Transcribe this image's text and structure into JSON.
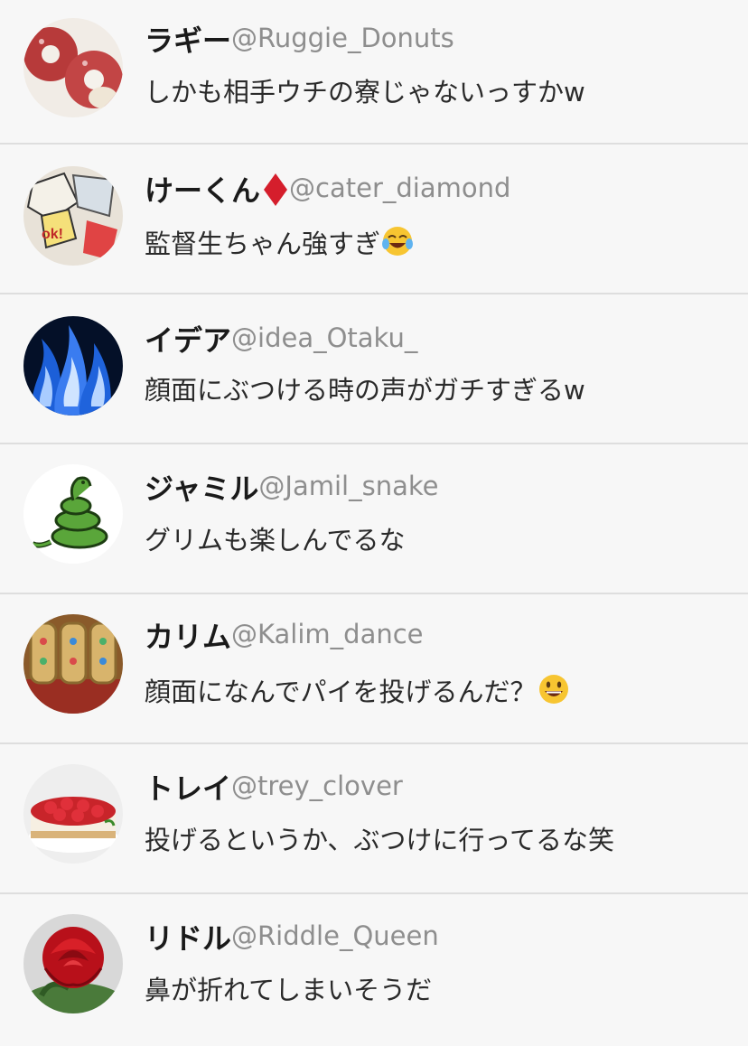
{
  "posts": [
    {
      "display_name": "ラギー",
      "handle": "@Ruggie_Donuts",
      "message": "しかも相手ウチの寮じゃないっすかw",
      "avatar": "donut-avatar"
    },
    {
      "display_name": "けーくん",
      "name_suffix_icon": "red-diamond-icon",
      "handle": "@cater_diamond",
      "message": "監督生ちゃん強すぎ",
      "message_emoji": "tears-of-joy-emoji",
      "avatar": "comic-avatar"
    },
    {
      "display_name": "イデア",
      "handle": "@idea_Otaku_",
      "message": "顔面にぶつける時の声がガチすぎるw",
      "avatar": "blue-flame-avatar"
    },
    {
      "display_name": "ジャミル",
      "handle": "@Jamil_snake",
      "message": "グリムも楽しんでるな",
      "avatar": "snake-avatar"
    },
    {
      "display_name": "カリム",
      "handle": "@Kalim_dance",
      "message": "顔面になんでパイを投げるんだ？",
      "message_emoji": "grinning-face-emoji",
      "avatar": "ornate-box-avatar"
    },
    {
      "display_name": "トレイ",
      "handle": "@trey_clover",
      "message": "投げるというか、ぶつけに行ってるな笑",
      "avatar": "strawberry-cake-avatar"
    },
    {
      "display_name": "リドル",
      "handle": "@Riddle_Queen",
      "message": "鼻が折れてしまいそうだ",
      "avatar": "red-rose-avatar"
    }
  ],
  "colors": {
    "background": "#f7f7f7",
    "divider": "#dedede",
    "handle": "#8e8e8e",
    "name": "#1a1a1a"
  }
}
